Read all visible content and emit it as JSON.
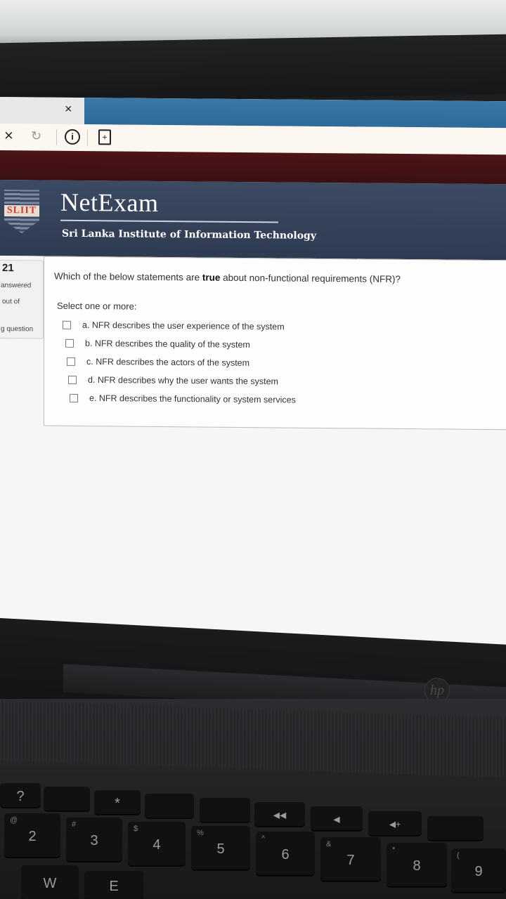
{
  "browser": {
    "tab_close": "×",
    "stop_icon": "×",
    "reload_icon": "↻",
    "info_icon": "i",
    "page_icon": "+"
  },
  "site": {
    "logo_text": "SLIIT",
    "brand": "NetExam",
    "institute": "Sri Lanka Institute of Information Technology",
    "accent_color": "#e87a2a",
    "header_color": "#3c4a63"
  },
  "question_info": {
    "number": "21",
    "state": "answered",
    "mark": "out of",
    "flag": "g question"
  },
  "question": {
    "text_before": "Which of the below statements are ",
    "text_bold": "true",
    "text_after": " about non-functional requirements (NFR)?",
    "prompt": "Select one or more:",
    "options": [
      {
        "label": "a. NFR describes the user experience of the system",
        "checked": false
      },
      {
        "label": "b. NFR describes the quality of the system",
        "checked": false
      },
      {
        "label": "c. NFR describes the actors of the system",
        "checked": false
      },
      {
        "label": "d. NFR describes why the user wants the system",
        "checked": false
      },
      {
        "label": "e. NFR describes the functionality or system services",
        "checked": false
      }
    ]
  },
  "laptop": {
    "brand_logo": "hp",
    "keys_fn": [
      "?",
      "",
      "*",
      "",
      "",
      "◀◀",
      "◀",
      "◀+",
      ""
    ],
    "keys_num": [
      {
        "main": "2",
        "sup": "@"
      },
      {
        "main": "3",
        "sup": "#"
      },
      {
        "main": "4",
        "sup": "$"
      },
      {
        "main": "5",
        "sup": "%"
      },
      {
        "main": "6",
        "sup": "^"
      },
      {
        "main": "7",
        "sup": "&"
      },
      {
        "main": "8",
        "sup": "*"
      },
      {
        "main": "9",
        "sup": "("
      }
    ],
    "keys_letters": [
      "W",
      "E"
    ]
  }
}
